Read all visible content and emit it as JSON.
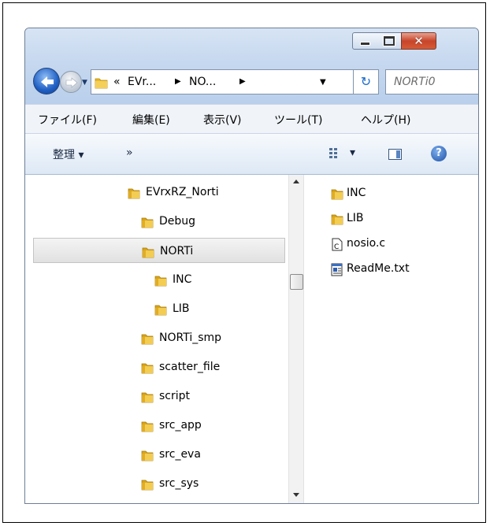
{
  "address": {
    "crumbs": [
      "«",
      "EVr...",
      "NO..."
    ],
    "search_placeholder": "NORTi0"
  },
  "window_controls": {
    "close_glyph": "✕"
  },
  "menu": [
    "ファイル(F)",
    "編集(E)",
    "表示(V)",
    "ツール(T)",
    "ヘルプ(H)"
  ],
  "toolbar": {
    "organize": "整理 ▾",
    "more": "»",
    "view_dropdown": "▾",
    "help": "?"
  },
  "tree": [
    {
      "label": "EVrxRZ_Norti",
      "level": 0,
      "selected": false
    },
    {
      "label": "Debug",
      "level": 1,
      "selected": false
    },
    {
      "label": "NORTi",
      "level": 1,
      "selected": true
    },
    {
      "label": "INC",
      "level": 2,
      "selected": false
    },
    {
      "label": "LIB",
      "level": 2,
      "selected": false
    },
    {
      "label": "NORTi_smp",
      "level": 1,
      "selected": false
    },
    {
      "label": "scatter_file",
      "level": 1,
      "selected": false
    },
    {
      "label": "script",
      "level": 1,
      "selected": false
    },
    {
      "label": "src_app",
      "level": 1,
      "selected": false
    },
    {
      "label": "src_eva",
      "level": 1,
      "selected": false
    },
    {
      "label": "src_sys",
      "level": 1,
      "selected": false
    }
  ],
  "files": [
    {
      "label": "INC",
      "icon": "folder-icon"
    },
    {
      "label": "LIB",
      "icon": "folder-icon"
    },
    {
      "label": "nosio.c",
      "icon": "c-file-icon"
    },
    {
      "label": "ReadMe.txt",
      "icon": "text-file-icon"
    }
  ],
  "colors": {
    "folder": "#e8b923",
    "accent": "#1f5fc4"
  }
}
